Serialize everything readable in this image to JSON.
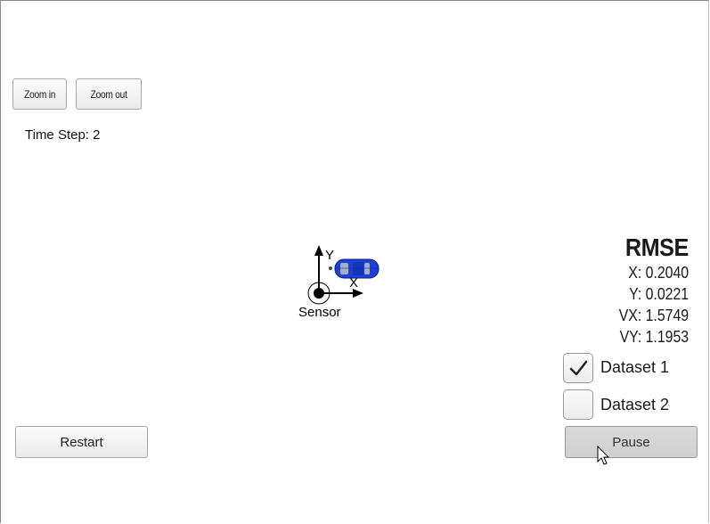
{
  "controls": {
    "zoom_in_label": "Zoom in",
    "zoom_out_label": "Zoom out",
    "restart_label": "Restart",
    "pause_label": "Pause"
  },
  "status": {
    "time_step_label": "Time Step:",
    "time_step_value": "2"
  },
  "scene": {
    "sensor_label": "Sensor",
    "x_axis_label": "X",
    "y_axis_label": "Y",
    "vehicle_icon": "blue-car-icon",
    "vehicle_color": "#1f3fd6"
  },
  "rmse": {
    "title": "RMSE",
    "x": "X: 0.2040",
    "y": "Y: 0.0221",
    "vx": "VX: 1.5749",
    "vy": "VY: 1.1953"
  },
  "datasets": [
    {
      "label": "Dataset 1",
      "checked": true
    },
    {
      "label": "Dataset 2",
      "checked": false
    }
  ]
}
